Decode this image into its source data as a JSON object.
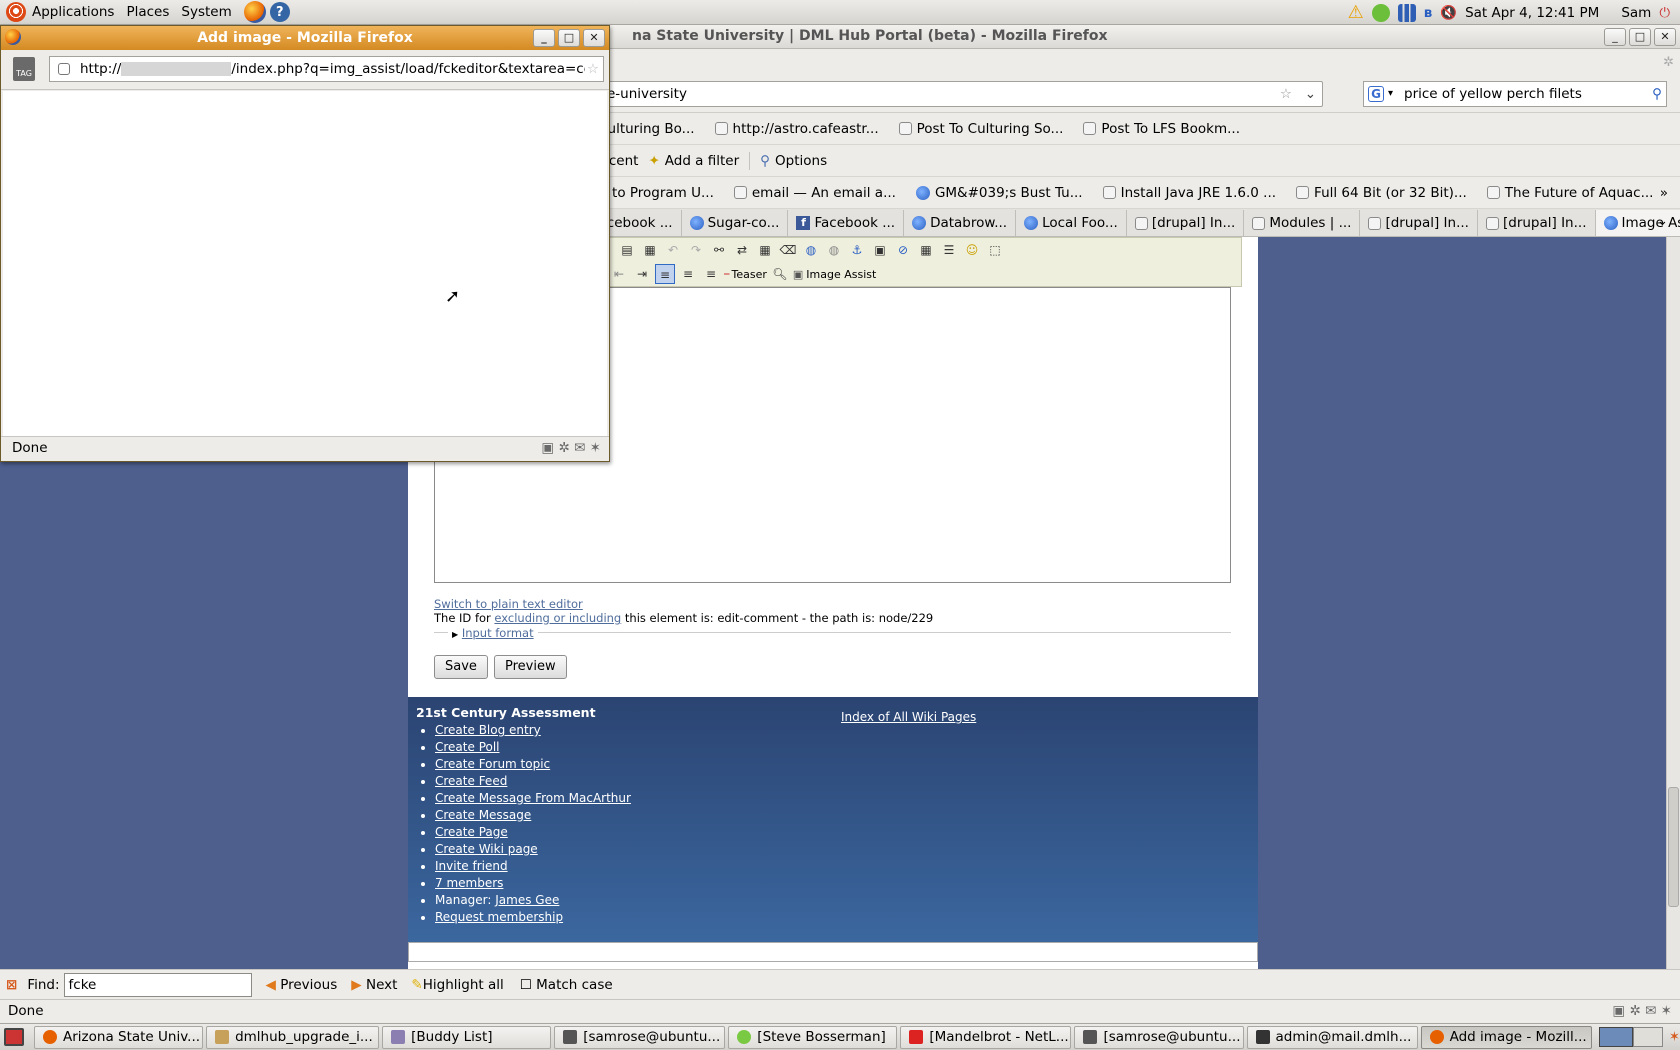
{
  "top_panel": {
    "menus": [
      "Applications",
      "Places",
      "System"
    ],
    "clock": "Sat Apr  4, 12:41 PM",
    "user": "Sam"
  },
  "main_window": {
    "title": "Arizona State University | DML Hub Portal (beta) - Mozilla Firefox",
    "title_visible": "na State University | DML Hub Portal (beta) - Mozilla Firefox",
    "url_visible": "e-university",
    "search_value": "price of yellow perch filets",
    "bookmarks": [
      {
        "label": "t To Culturing Bo...",
        "icon": "page-icon"
      },
      {
        "label": "http://astro.cafeastr...",
        "icon": "page-icon"
      },
      {
        "label": "Post To Culturing So...",
        "icon": "page-icon"
      },
      {
        "label": "Post To LFS Bookm...",
        "icon": "page-icon"
      }
    ],
    "tag_toolbar": {
      "recent": "Recent",
      "add_filter": "Add a filter",
      "options": "Options"
    },
    "bookmarks2": [
      {
        "label": "Learn to Program U...",
        "icon": "none"
      },
      {
        "label": "email — An email a...",
        "icon": "page-icon"
      },
      {
        "label": "GM&#039;s Bust Tu...",
        "icon": "firefox-icon"
      },
      {
        "label": "Install Java JRE 1.6.0 ...",
        "icon": "page-icon"
      },
      {
        "label": "Full 64 Bit (or 32 Bit)...",
        "icon": "page-icon"
      },
      {
        "label": "The Future of Aquac...",
        "icon": "page-icon"
      }
    ],
    "tabs": [
      {
        "label": "Facebook ...",
        "icon": "facebook-icon"
      },
      {
        "label": "Sugar-co...",
        "icon": "firefox-icon"
      },
      {
        "label": "Facebook ...",
        "icon": "facebook-icon"
      },
      {
        "label": "Databrow...",
        "icon": "firefox-icon"
      },
      {
        "label": "Local Foo...",
        "icon": "firefox-icon"
      },
      {
        "label": "[drupal] In...",
        "icon": "page-icon"
      },
      {
        "label": "Modules | ...",
        "icon": "page-icon"
      },
      {
        "label": "[drupal] In...",
        "icon": "page-icon"
      },
      {
        "label": "[drupal] In...",
        "icon": "page-icon"
      },
      {
        "label": "Image As...",
        "icon": "firefox-icon"
      }
    ],
    "editor": {
      "teaser": "Teaser",
      "image_assist": "Image Assist",
      "switch_link": "Switch to plain text editor",
      "id_prefix": "The ID for",
      "id_link": "excluding or including",
      "id_suffix": "this element is: edit-comment - the path is: node/229",
      "input_format": "Input format",
      "save": "Save",
      "preview": "Preview"
    },
    "footer": {
      "heading": "21st Century Assessment",
      "index_link": "Index of All Wiki Pages",
      "links": [
        "Create Blog entry",
        "Create Poll",
        "Create Forum topic",
        "Create Feed",
        "Create Message From MacArthur",
        "Create Message",
        "Create Page",
        "Create Wiki page",
        "Invite friend",
        "7 members"
      ],
      "manager_label": "Manager:",
      "manager_name": "James Gee",
      "request": "Request membership"
    },
    "find": {
      "label": "Find:",
      "value": "fcke",
      "previous": "Previous",
      "next": "Next",
      "highlight": "Highlight all",
      "match_case": "Match case"
    },
    "status": "Done"
  },
  "popup": {
    "title": "Add image - Mozilla Firefox",
    "url_prefix": "http://",
    "url_suffix": "/index.php?q=img_assist/load/fckeditor&textarea=cor",
    "status": "Done"
  },
  "taskbar": [
    {
      "label": "Arizona State Univ...",
      "icon_color": "#e66000"
    },
    {
      "label": "dmlhub_upgrade_i...",
      "icon_color": "#c7a15a"
    },
    {
      "label": "[Buddy List]",
      "icon_color": "#8a7fb0"
    },
    {
      "label": "[samrose@ubuntu...",
      "icon_color": "#555555"
    },
    {
      "label": "[Steve Bosserman]",
      "icon_color": "#7ac943"
    },
    {
      "label": "[Mandelbrot - NetL...",
      "icon_color": "#d22"
    },
    {
      "label": "[samrose@ubuntu...",
      "icon_color": "#555555"
    },
    {
      "label": "admin@mail.dmlh...",
      "icon_color": "#333333"
    },
    {
      "label": "Add image - Mozill...",
      "icon_color": "#e66000"
    }
  ]
}
